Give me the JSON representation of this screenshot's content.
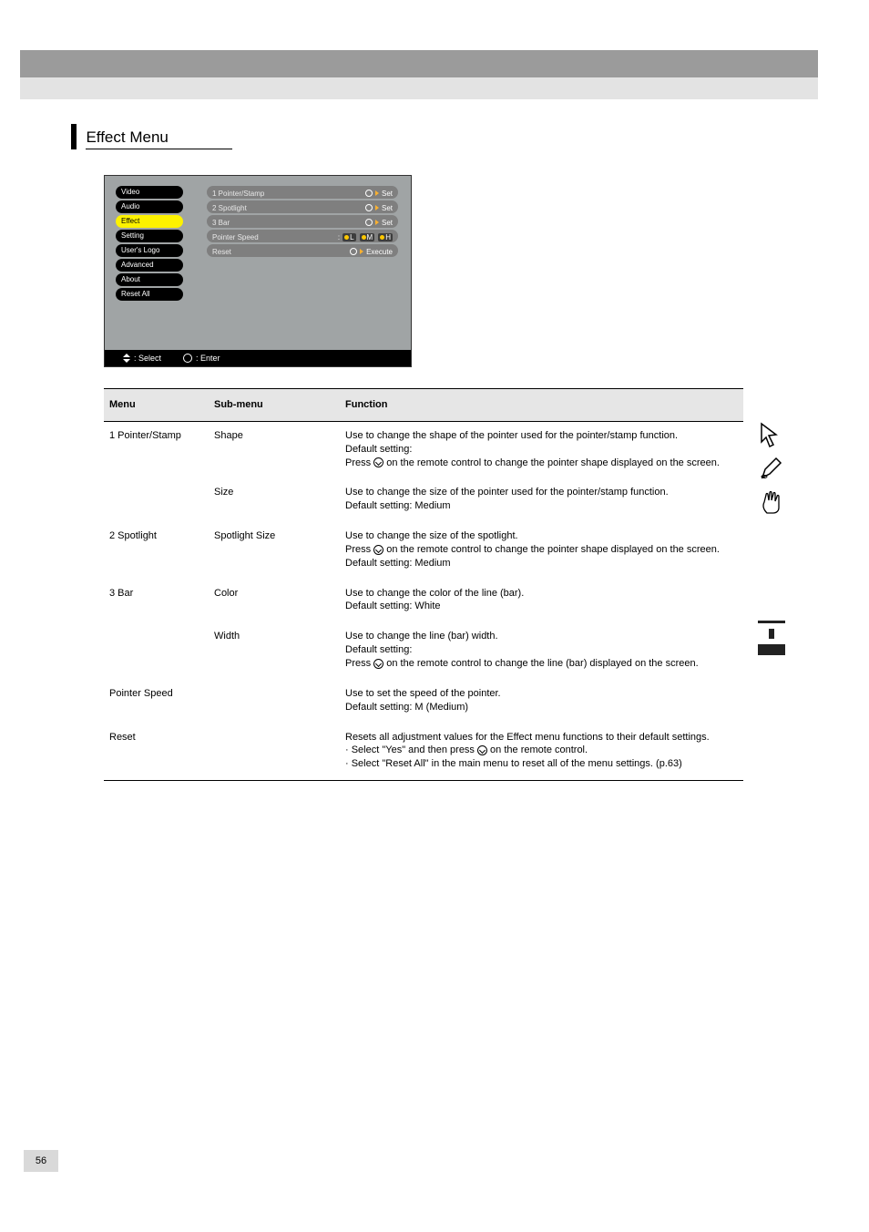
{
  "section_title": "Effect Menu",
  "menu": {
    "left_items": [
      "Video",
      "Audio",
      "Effect",
      "Setting",
      "User's Logo",
      "Advanced",
      "About",
      "Reset All"
    ],
    "selected": "Effect",
    "right": [
      {
        "label": "1  Pointer/Stamp",
        "value": "Set",
        "icon": true
      },
      {
        "label": "2  Spotlight",
        "value": "Set",
        "icon": true
      },
      {
        "label": "3  Bar",
        "value": "Set",
        "icon": true
      },
      {
        "label": "Pointer Speed",
        "value": "",
        "lmh": true
      },
      {
        "label": "Reset",
        "value": "Execute",
        "icon": true
      }
    ],
    "lmh_labels": [
      "L",
      "M",
      "H"
    ],
    "footer": {
      "select": ": Select",
      "enter": ": Enter"
    }
  },
  "table": {
    "headers": [
      "Menu",
      "Sub-menu",
      "Function"
    ],
    "rows": [
      {
        "menu": "1 Pointer/Stamp",
        "subs": [
          {
            "sub": "Shape",
            "func": "Use to change the shape of the pointer used for the pointer/stamp function.\nDefault setting: \nPress ⏎ on the remote control to change the pointer shape displayed on the screen."
          },
          {
            "sub": "Size",
            "func": "Use to change the size of the pointer used for the pointer/stamp function.\nDefault setting: Medium"
          }
        ]
      },
      {
        "menu": "2 Spotlight",
        "subs": [
          {
            "sub": "Spotlight Size",
            "func": "Use to change the size of the spotlight.\nPress ⏎ on the remote control to change the pointer shape displayed on the screen.\nDefault setting: Medium"
          }
        ]
      },
      {
        "menu": "3 Bar",
        "subs": [
          {
            "sub": "Color",
            "func": "Use to change the color of the line (bar).\nDefault setting: White"
          },
          {
            "sub": "Width",
            "func": "Use to change the line (bar) width.\nDefault setting: \nPress ⏎ on the remote control to change the line (bar) displayed on the screen."
          }
        ]
      },
      {
        "menu": "Pointer Speed",
        "subs": [
          {
            "sub": "",
            "func": "Use to set the speed of the pointer.\nDefault setting: M (Medium)"
          }
        ]
      },
      {
        "menu": "Reset",
        "subs": [
          {
            "sub": "",
            "func": "Resets all adjustment values for the Effect menu functions to their default settings.\n· Select \"Yes\" and then press ⏎ on the remote control.\n· Select \"Reset All\" in the main menu to reset all of the menu settings. (p.63)"
          }
        ]
      }
    ]
  },
  "page": "56"
}
